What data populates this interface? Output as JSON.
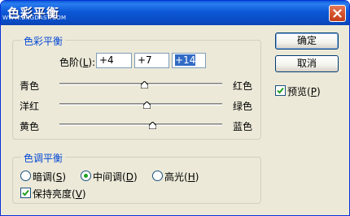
{
  "window": {
    "title": "色彩平衡",
    "watermark": "WWW.ENGDAST.COM"
  },
  "color_balance": {
    "group_title": "色彩平衡",
    "levels_label": "色阶(L):",
    "levels": [
      "+4",
      "+7",
      "+14"
    ],
    "sliders": [
      {
        "left": "青色",
        "right": "红色",
        "value": 4
      },
      {
        "left": "洋红",
        "right": "绿色",
        "value": 7
      },
      {
        "left": "黄色",
        "right": "蓝色",
        "value": 14
      }
    ],
    "slider_range": [
      -100,
      100
    ]
  },
  "tone_balance": {
    "group_title": "色调平衡",
    "options": [
      {
        "label": "暗调(S)",
        "checked": false
      },
      {
        "label": "中间调(D)",
        "checked": true
      },
      {
        "label": "高光(H)",
        "checked": false
      }
    ],
    "preserve_luminosity": {
      "label": "保持亮度(V)",
      "checked": true
    }
  },
  "buttons": {
    "ok": "确定",
    "cancel": "取消"
  },
  "preview": {
    "label": "预览(P)",
    "checked": true
  },
  "colors": {
    "accent": "#0046d5",
    "titlebar": "#0a4dc6",
    "close": "#d5542e"
  }
}
